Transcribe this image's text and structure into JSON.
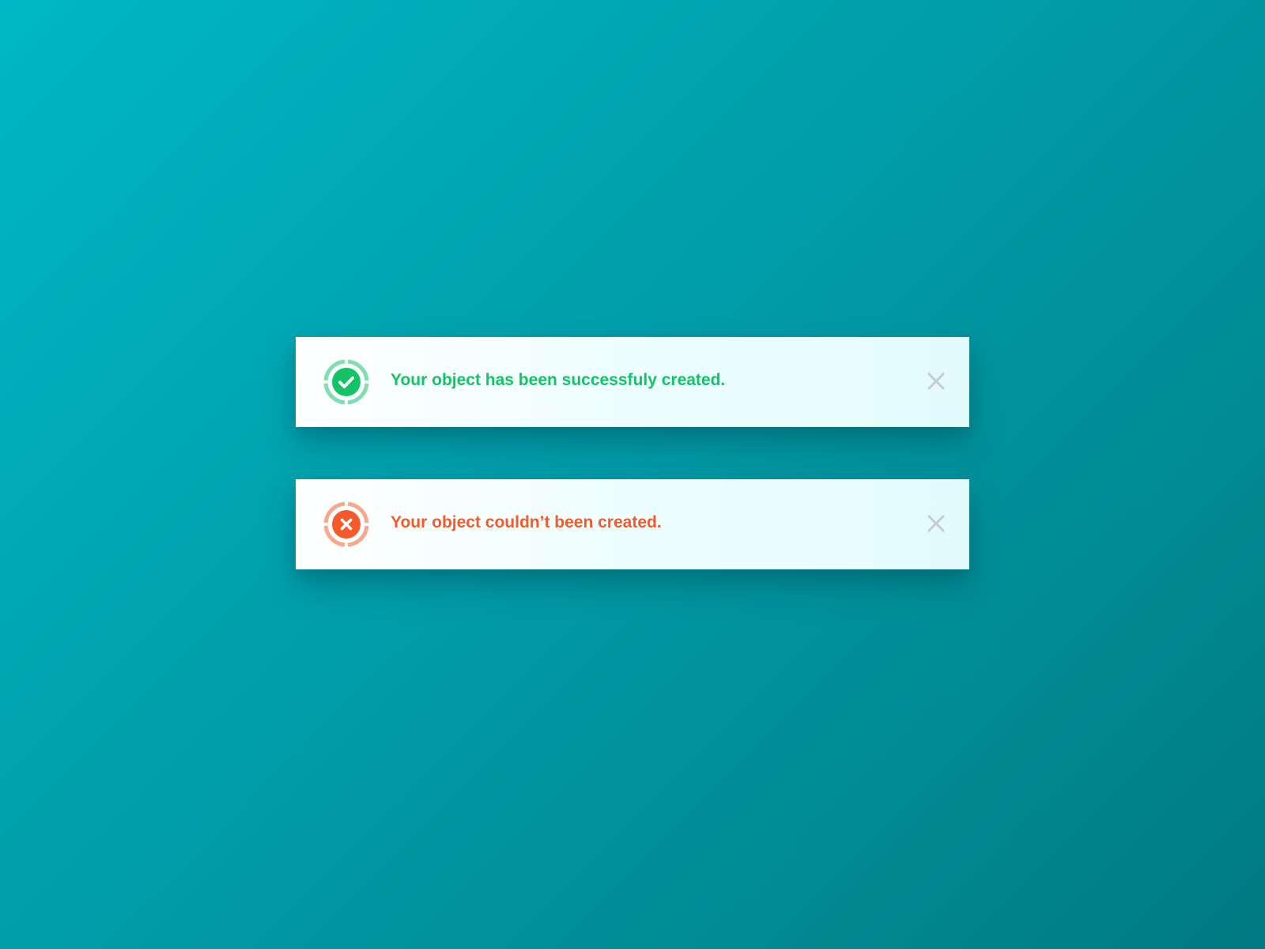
{
  "colors": {
    "success": "#13c466",
    "success_ring": "#7fdfae",
    "error": "#f45a2a",
    "error_ring": "#f7a98e",
    "close": "#c3cdd1"
  },
  "notifications": [
    {
      "type": "success",
      "icon": "check-circle-icon",
      "message": "Your object has been successfuly created.",
      "close_icon": "close-icon"
    },
    {
      "type": "error",
      "icon": "x-circle-icon",
      "message": "Your object couldn’t been created.",
      "close_icon": "close-icon"
    }
  ]
}
